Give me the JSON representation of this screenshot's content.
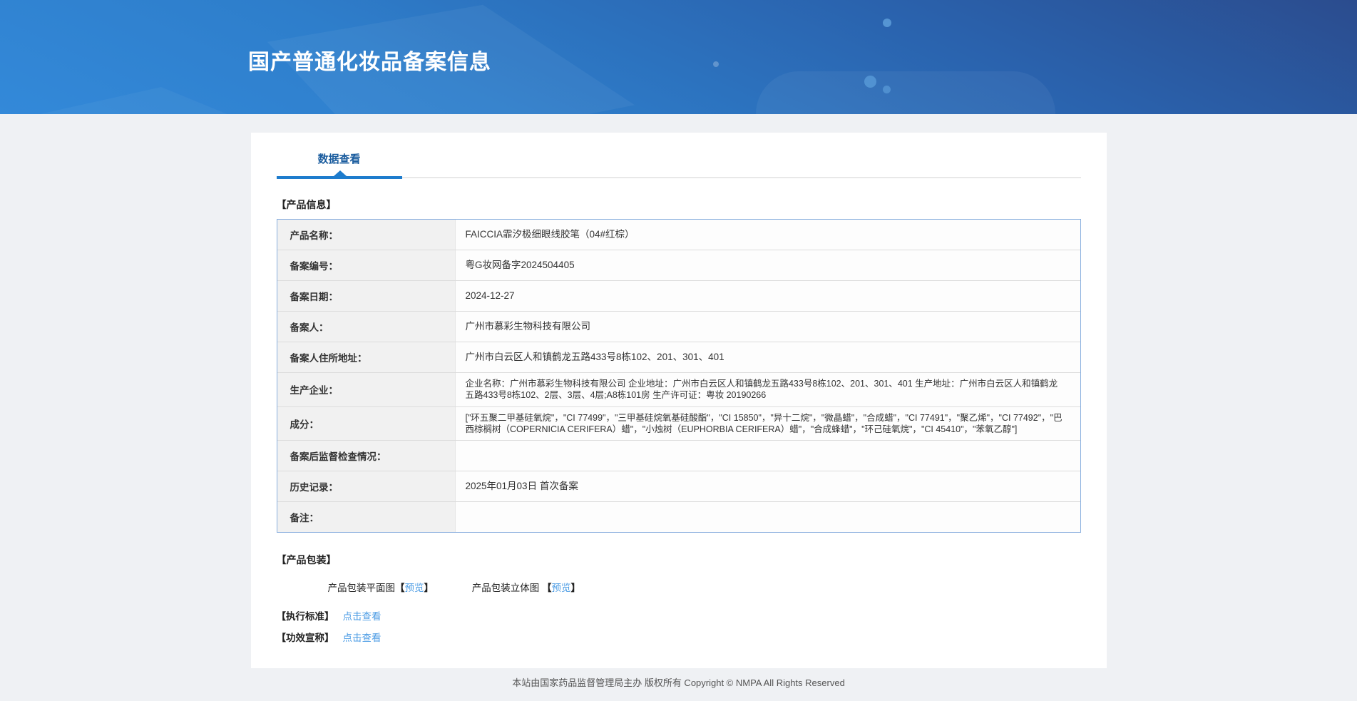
{
  "header": {
    "title": "国产普通化妆品备案信息"
  },
  "tabs": {
    "data_view": "数据查看"
  },
  "product_info": {
    "section_title": "【产品信息】",
    "rows": [
      {
        "label": "产品名称：",
        "value": "FAICCIA霏汐极细眼线胶笔（04#红棕）"
      },
      {
        "label": "备案编号：",
        "value": "粤G妆网备字2024504405"
      },
      {
        "label": "备案日期：",
        "value": "2024-12-27"
      },
      {
        "label": "备案人：",
        "value": "广州市慕彩生物科技有限公司"
      },
      {
        "label": "备案人住所地址：",
        "value": "广州市白云区人和镇鹤龙五路433号8栋102、201、301、401"
      },
      {
        "label": "生产企业：",
        "value": "企业名称：广州市慕彩生物科技有限公司 企业地址：广州市白云区人和镇鹤龙五路433号8栋102、201、301、401 生产地址：广州市白云区人和镇鹤龙五路433号8栋102、2层、3层、4层;A8栋101房 生产许可证：粤妆 20190266"
      },
      {
        "label": "成分：",
        "value": "[\"环五聚二甲基硅氧烷\"，\"CI 77499\"，\"三甲基硅烷氧基硅酸酯\"，\"CI 15850\"，\"异十二烷\"，\"微晶蜡\"，\"合成蜡\"，\"CI 77491\"，\"聚乙烯\"，\"CI 77492\"，\"巴西棕榈树（COPERNICIA CERIFERA）蜡\"，\"小烛树（EUPHORBIA CERIFERA）蜡\"，\"合成蜂蜡\"，\"环己硅氧烷\"，\"CI 45410\"，\"苯氧乙醇\"]"
      },
      {
        "label": "备案后监督检查情况：",
        "value": ""
      },
      {
        "label": "历史记录：",
        "value": "2025年01月03日 首次备案"
      },
      {
        "label": "备注：",
        "value": ""
      }
    ]
  },
  "packaging": {
    "section_title": "【产品包装】",
    "flat_label": "产品包装平面图",
    "stereo_label": "产品包装立体图 ",
    "bracket_open": "【",
    "bracket_close": "】",
    "preview_link": "预览"
  },
  "standard": {
    "label": "【执行标准】",
    "link": "点击查看"
  },
  "efficacy": {
    "label": "【功效宣称】",
    "link": "点击查看"
  },
  "footer": {
    "text": "本站由国家药品监督管理局主办 版权所有 Copyright © NMPA All Rights Reserved"
  },
  "colors": {
    "accent_blue": "#1e7ccd",
    "tab_text": "#1a5c9e",
    "link_blue": "#4a9be4",
    "table_border": "#88aede",
    "label_bg": "#f1f1f1",
    "header_gradient_top_right": "#2b4c8e",
    "header_gradient_bottom_left": "#3389d9",
    "page_bg": "#eff1f4"
  }
}
